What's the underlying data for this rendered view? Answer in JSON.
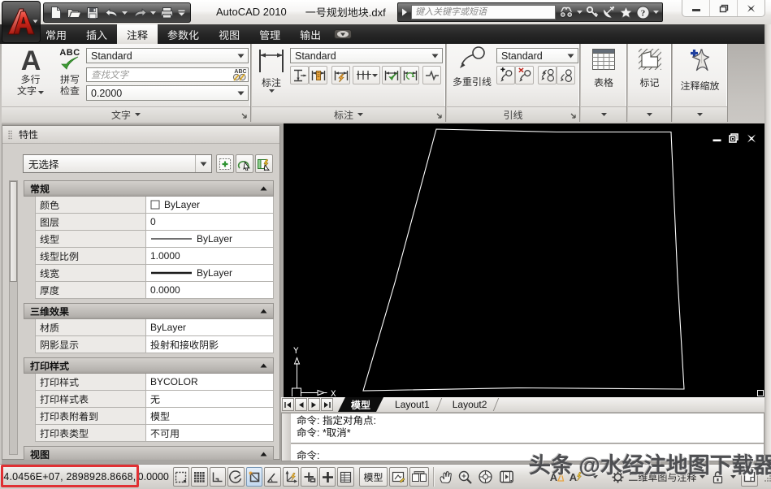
{
  "window": {
    "app_title": "AutoCAD 2010",
    "doc_title": "一号规划地块.dxf"
  },
  "infocenter": {
    "search_placeholder": "键入关键字或短语"
  },
  "ribbon": {
    "tabs": [
      {
        "label": "常用"
      },
      {
        "label": "插入"
      },
      {
        "label": "注释"
      },
      {
        "label": "参数化"
      },
      {
        "label": "视图"
      },
      {
        "label": "管理"
      },
      {
        "label": "输出"
      }
    ],
    "active_tab": "注释",
    "text_panel": {
      "footer": "文字",
      "mtext_lines": [
        "多行",
        "文字"
      ],
      "spell_lines": [
        "拼写",
        "检查"
      ],
      "abc": "ABC",
      "style_value": "Standard",
      "find_placeholder": "查找文字",
      "height_value": "0.2000"
    },
    "dim_panel": {
      "footer": "标注",
      "big_label": "标注",
      "style_value": "Standard"
    },
    "leader_panel": {
      "footer": "引线",
      "big_label": "多重引线",
      "style_value": "Standard"
    },
    "table_panel": {
      "label": "表格"
    },
    "markup_panel": {
      "label": "标记"
    },
    "annoscale_panel": {
      "label": "注释缩放"
    }
  },
  "properties_palette": {
    "title": "特性",
    "selection_value": "无选择",
    "sections": [
      {
        "name": "常规",
        "rows": [
          {
            "label": "颜色",
            "value": "ByLayer",
            "swatch": "color"
          },
          {
            "label": "图层",
            "value": "0"
          },
          {
            "label": "线型",
            "value": "ByLayer",
            "swatch": "thinline"
          },
          {
            "label": "线型比例",
            "value": "1.0000"
          },
          {
            "label": "线宽",
            "value": "ByLayer",
            "swatch": "thickline"
          },
          {
            "label": "厚度",
            "value": "0.0000"
          }
        ]
      },
      {
        "name": "三维效果",
        "rows": [
          {
            "label": "材质",
            "value": "ByLayer"
          },
          {
            "label": "阴影显示",
            "value": "投射和接收阴影"
          }
        ]
      },
      {
        "name": "打印样式",
        "rows": [
          {
            "label": "打印样式",
            "value": "BYCOLOR"
          },
          {
            "label": "打印样式表",
            "value": "无"
          },
          {
            "label": "打印表附着到",
            "value": "模型"
          },
          {
            "label": "打印表类型",
            "value": "不可用"
          }
        ]
      },
      {
        "name": "视图",
        "rows": []
      }
    ]
  },
  "drawing_area": {
    "layout_tabs": [
      "模型",
      "Layout1",
      "Layout2"
    ],
    "active_layout_tab": "模型",
    "ucs_x_label": "X",
    "ucs_y_label": "Y"
  },
  "command_line": {
    "history": [
      "命令: 指定对角点:",
      "命令: *取消*"
    ],
    "prompt": "命令:"
  },
  "status_bar": {
    "coordinates": "4.0456E+07, 2898928.8668,",
    "z_coordinate": "0.0000",
    "model_button": "模型",
    "workspace": "二维草图与注释"
  },
  "watermark": "头条 @水经注地图下载器",
  "colors": {
    "accent_red_box": "#e03033",
    "canvas": "#000000",
    "osnap_active": "#cfe3f5",
    "logo_red": "#c21f17",
    "check_green": "#3f9c35",
    "annoscale_blue": "#1f3f9e"
  }
}
